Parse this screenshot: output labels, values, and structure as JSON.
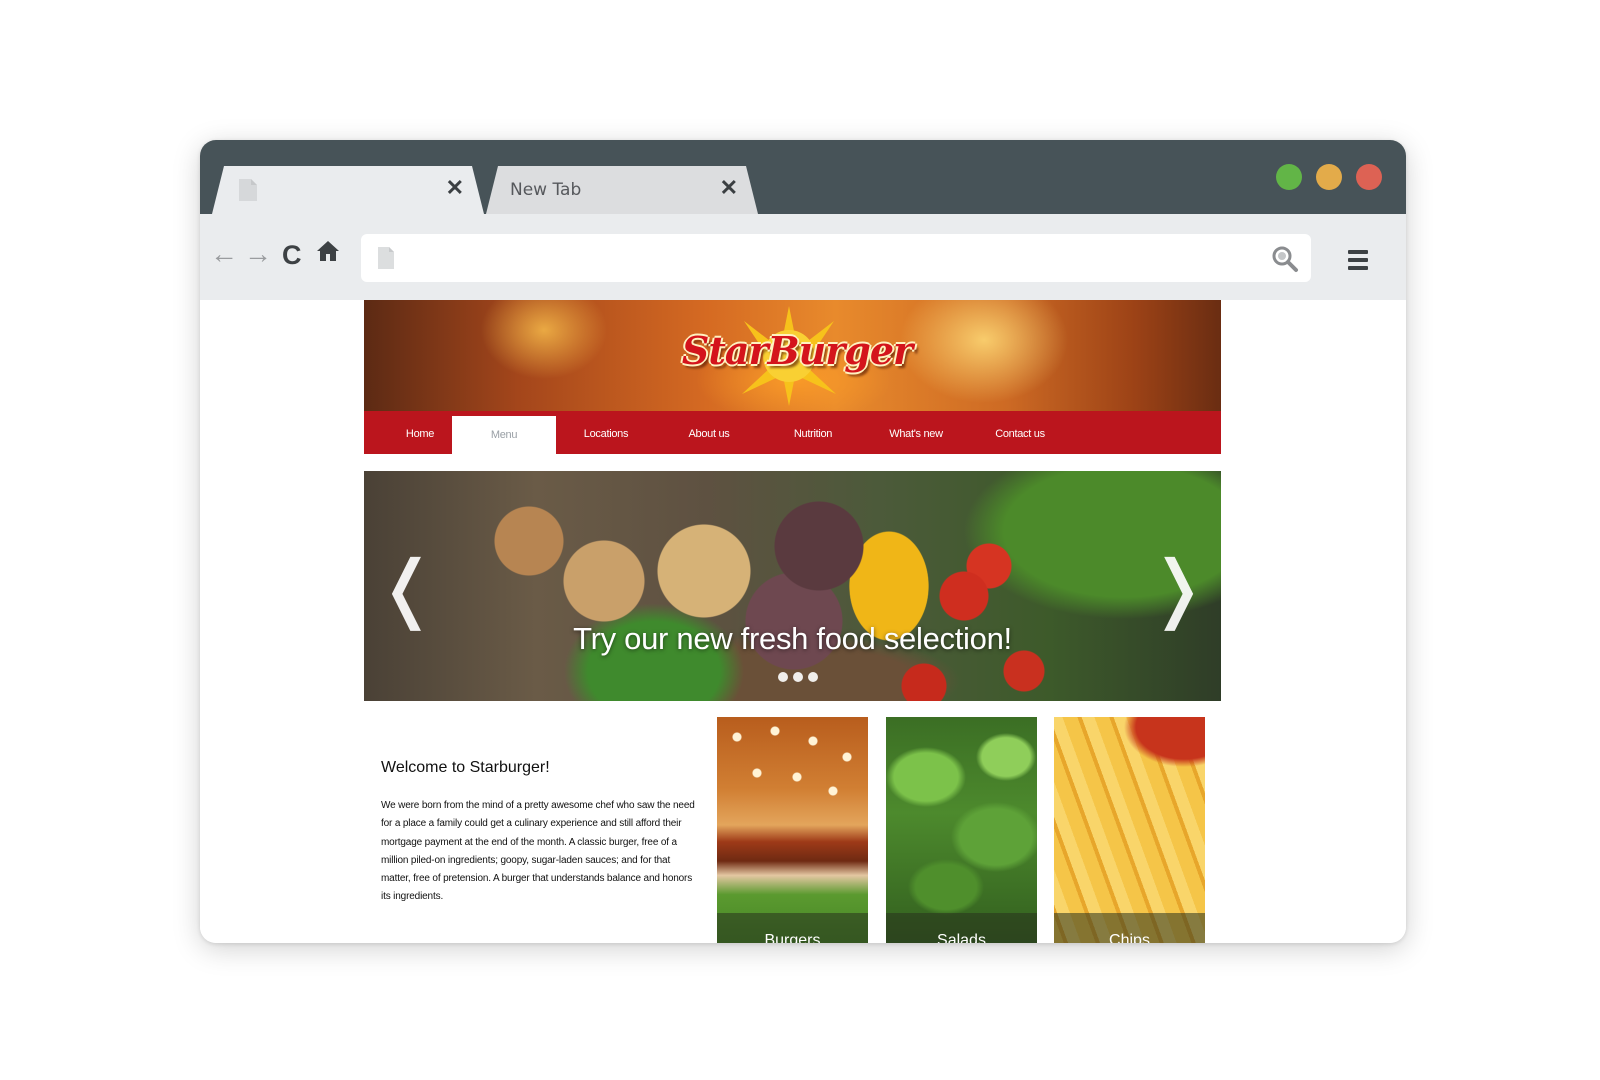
{
  "browser": {
    "tabs": [
      {
        "label": "",
        "active": true
      },
      {
        "label": "New Tab",
        "active": false
      }
    ],
    "tab_close_glyph": "✕",
    "traffic_lights": {
      "green": "#62b547",
      "yellow": "#e3ab4a",
      "red": "#dd6254"
    },
    "toolbar": {
      "back_glyph": "←",
      "forward_glyph": "→",
      "reload_glyph": "C",
      "address_value": "",
      "icons": [
        "back-arrow-icon",
        "forward-arrow-icon",
        "reload-icon",
        "home-icon",
        "page-icon",
        "search-icon",
        "hamburger-menu-icon"
      ]
    }
  },
  "site": {
    "logo_text": "StarBurger",
    "accent_color": "#bb151d",
    "nav": {
      "items": [
        {
          "label": "Home",
          "active": false
        },
        {
          "label": "Menu",
          "active": true
        },
        {
          "label": "Locations",
          "active": false
        },
        {
          "label": "About us",
          "active": false
        },
        {
          "label": "Nutrition",
          "active": false
        },
        {
          "label": "What's new",
          "active": false
        },
        {
          "label": "Contact us",
          "active": false
        }
      ]
    },
    "slider": {
      "caption": "Try our new fresh food selection!",
      "prev_glyph": "❬",
      "next_glyph": "❭",
      "dot_count": 3
    },
    "welcome": {
      "heading": "Welcome to Starburger!",
      "body": "We were born from the mind of a pretty awesome chef who saw the need for a place a family could get a culinary experience and still afford their mortgage payment at the end of the month. A classic burger, free of a million piled-on ingredients; goopy, sugar-laden sauces; and for that matter, free of pretension. A burger that understands balance and honors its ingredients."
    },
    "categories": [
      {
        "label": "Burgers"
      },
      {
        "label": "Salads"
      },
      {
        "label": "Chips"
      }
    ]
  }
}
